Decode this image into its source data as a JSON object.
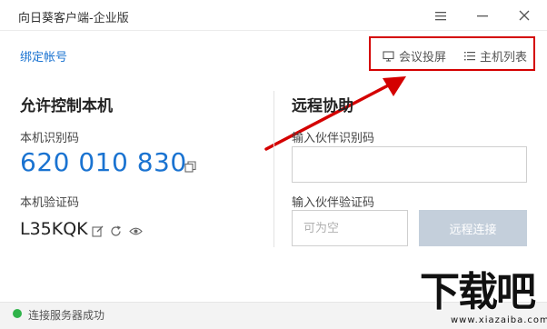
{
  "window": {
    "title": "向日葵客户端-企业版"
  },
  "header": {
    "bind_account": "绑定帐号",
    "meeting_cast": "会议投屏",
    "host_list": "主机列表"
  },
  "allow_control": {
    "title": "允许控制本机",
    "id_label": "本机识别码",
    "id_value": "620 010 830",
    "code_label": "本机验证码",
    "code_value": "L35KQK"
  },
  "remote_assist": {
    "title": "远程协助",
    "partner_id_label": "输入伙伴识别码",
    "partner_id_value": "",
    "partner_code_label": "输入伙伴验证码",
    "partner_code_placeholder": "可为空",
    "connect_button": "远程连接"
  },
  "status": {
    "text": "连接服务器成功",
    "color": "#2fb34a"
  },
  "watermark": {
    "main": "下载吧",
    "sub": "www.xiazaiba.com"
  },
  "colors": {
    "accent": "#1a73d1",
    "highlight": "#d40000",
    "button_disabled": "#c4cfdb"
  },
  "icons": [
    "menu-icon",
    "minimize-icon",
    "close-icon",
    "monitor-icon",
    "list-icon",
    "copy-icon",
    "edit-icon",
    "refresh-icon",
    "eye-icon"
  ]
}
